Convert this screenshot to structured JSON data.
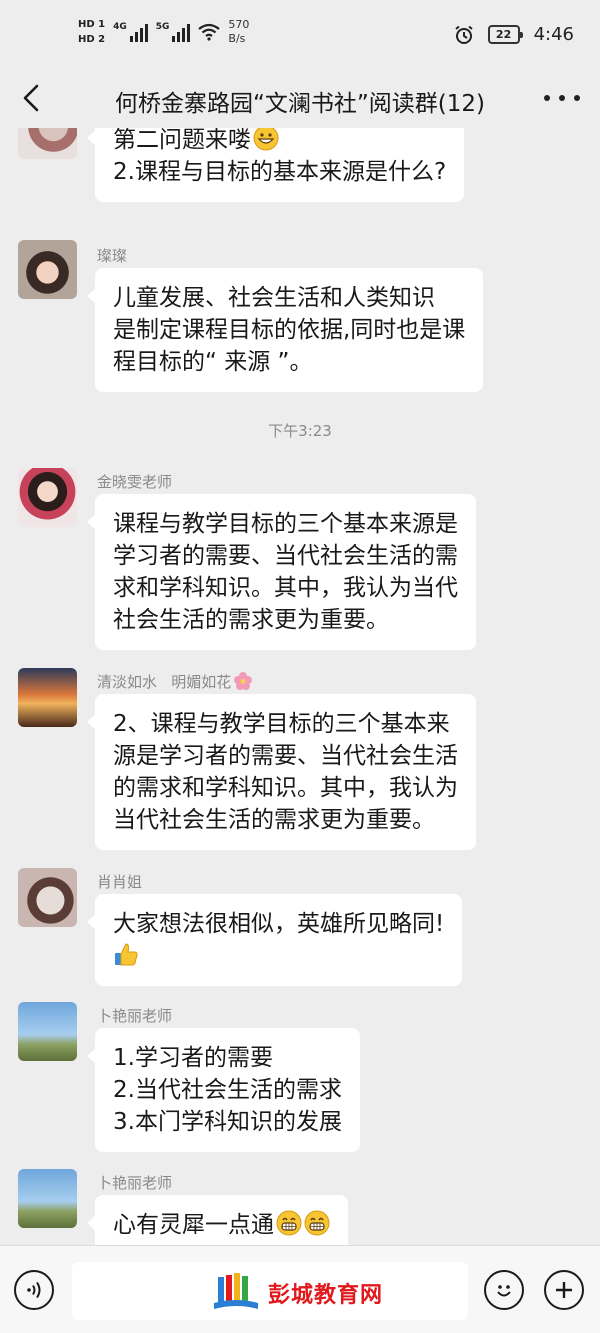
{
  "status_bar": {
    "hd1": "HD 1",
    "hd2": "HD 2",
    "net1": "4G",
    "net2": "5G",
    "speed_value": "570",
    "speed_unit": "B/s",
    "battery": "22",
    "time": "4:46"
  },
  "nav": {
    "title": "何桥金寨路园“文澜书社”阅读群(12)"
  },
  "messages": [
    {
      "sender": "",
      "lines": [
        "第二问题来喽",
        "2.课程与目标的基本来源是什么?"
      ],
      "emoji": [
        "grin-emoji"
      ]
    },
    {
      "sender": "璨璨",
      "lines": [
        " 儿童发展、社会生活和人类知识",
        "是制定课程目标的依据,同时也是课",
        "程目标的“ 来源 ”。"
      ]
    },
    {
      "sender": "金晓雯老师",
      "lines": [
        "课程与教学目标的三个基本来源是",
        "学习者的需要、当代社会生活的需",
        "求和学科知识。其中，我认为当代",
        "社会生活的需求更为重要。"
      ]
    },
    {
      "sender": "清淡如水   明媚如花",
      "sender_emoji": "flower-emoji",
      "lines": [
        "2、课程与教学目标的三个基本来",
        "源是学习者的需要、当代社会生活",
        "的需求和学科知识。其中，我认为",
        "当代社会生活的需求更为重要。"
      ]
    },
    {
      "sender": "肖肖姐",
      "lines": [
        "大家想法很相似，英雄所见略同!",
        ""
      ],
      "emoji": [
        "thumbs-up-emoji"
      ]
    },
    {
      "sender": "卜艳丽老师",
      "lines": [
        "1.学习者的需要",
        "2.当代社会生活的需求",
        "3.本门学科知识的发展"
      ]
    },
    {
      "sender": "卜艳丽老师",
      "lines": [
        "心有灵犀一点通"
      ],
      "emoji": [
        "grin-emoji",
        "grin-emoji"
      ]
    }
  ],
  "time_separator": "下午3:23",
  "watermark": {
    "text": "彭城教育网"
  },
  "colors": {
    "background": "#ededed",
    "bubble": "#ffffff",
    "watermark_red": "#e2191c"
  }
}
